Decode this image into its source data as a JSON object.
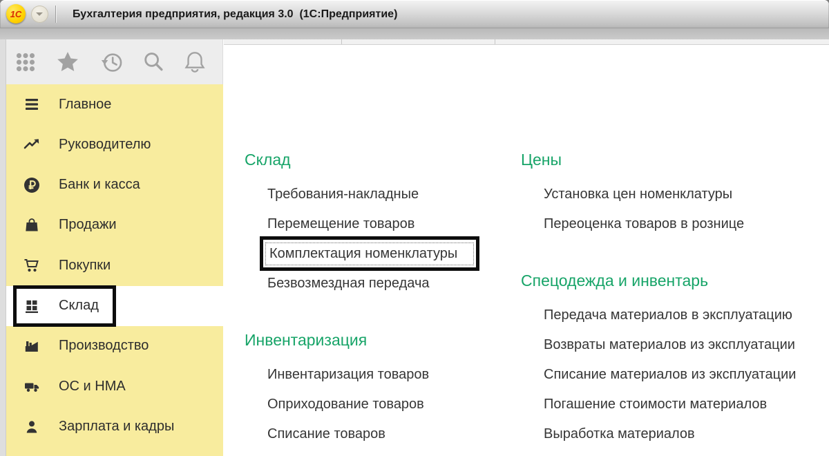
{
  "window": {
    "title": "Бухгалтерия предприятия, редакция 3.0  (1С:Предприятие)",
    "logo": "1С"
  },
  "toolbar": {
    "icons": [
      {
        "id": "apps-menu",
        "icon": "apps-grid-icon"
      },
      {
        "id": "favorites",
        "icon": "star-icon"
      },
      {
        "id": "history",
        "icon": "history-clock-icon"
      },
      {
        "id": "search",
        "icon": "search-icon"
      },
      {
        "id": "notifications",
        "icon": "bell-icon"
      }
    ]
  },
  "sidebar": {
    "items": [
      {
        "id": "glavnoe",
        "label": "Главное",
        "icon": "menu-icon"
      },
      {
        "id": "rukovoditelyu",
        "label": "Руководителю",
        "icon": "trend-up-icon"
      },
      {
        "id": "bank-i-kassa",
        "label": "Банк и касса",
        "icon": "ruble-icon"
      },
      {
        "id": "prodazhi",
        "label": "Продажи",
        "icon": "shopping-bag-icon"
      },
      {
        "id": "pokupki",
        "label": "Покупки",
        "icon": "shopping-cart-icon"
      },
      {
        "id": "sklad",
        "label": "Склад",
        "icon": "warehouse-icon",
        "selected": true,
        "annotated": true
      },
      {
        "id": "proizvodstvo",
        "label": "Производство",
        "icon": "factory-icon"
      },
      {
        "id": "os-i-nma",
        "label": "ОС и НМА",
        "icon": "truck-icon"
      },
      {
        "id": "zarplata-i-kadry",
        "label": "Зарплата и кадры",
        "icon": "person-icon"
      }
    ]
  },
  "main": {
    "columns": [
      {
        "sections": [
          {
            "title": "Склад",
            "items": [
              {
                "label": "Требования-накладные"
              },
              {
                "label": "Перемещение товаров"
              },
              {
                "label": "Комплектация номенклатуры",
                "annotated": true
              },
              {
                "label": "Безвозмездная передача"
              }
            ]
          },
          {
            "title": "Инвентаризация",
            "items": [
              {
                "label": "Инвентаризация товаров"
              },
              {
                "label": "Оприходование товаров"
              },
              {
                "label": "Списание товаров"
              }
            ]
          }
        ]
      },
      {
        "sections": [
          {
            "title": "Цены",
            "items": [
              {
                "label": "Установка цен номенклатуры"
              },
              {
                "label": "Переоценка товаров в рознице"
              }
            ]
          },
          {
            "title": "Спецодежда и инвентарь",
            "items": [
              {
                "label": "Передача материалов в эксплуатацию"
              },
              {
                "label": "Возвраты материалов из эксплуатации"
              },
              {
                "label": "Списание материалов из эксплуатации"
              },
              {
                "label": "Погашение стоимости материалов"
              },
              {
                "label": "Выработка материалов"
              }
            ]
          }
        ]
      }
    ]
  },
  "colors": {
    "sidebar_yellow": "#f8ec9e",
    "section_green": "#17a468",
    "annotation_black": "#0d0d0d",
    "selected_white": "#ffffff"
  }
}
